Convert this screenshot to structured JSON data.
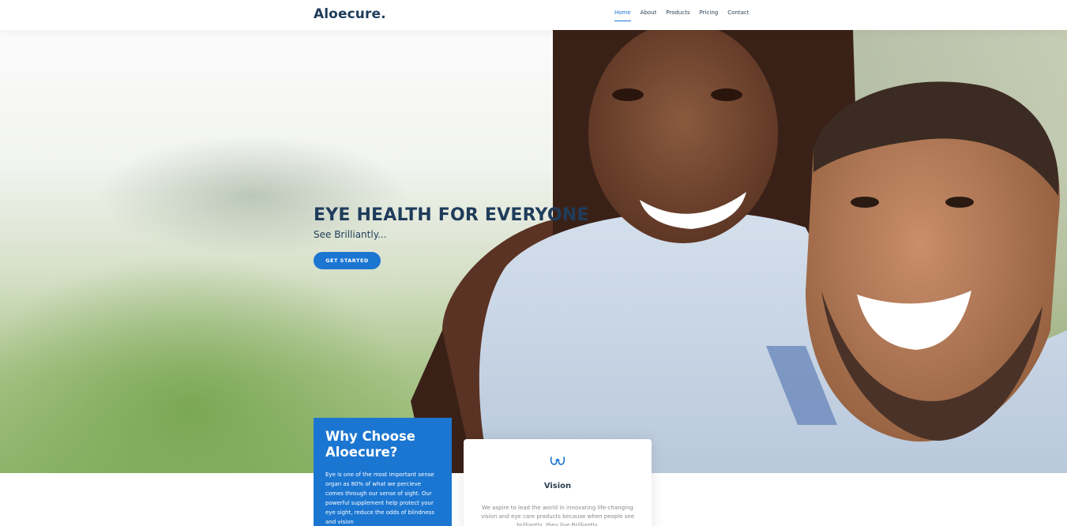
{
  "header": {
    "logo": "Aloecure.",
    "nav": [
      {
        "label": "Home",
        "active": true
      },
      {
        "label": "About",
        "active": false
      },
      {
        "label": "Products",
        "active": false
      },
      {
        "label": "Pricing",
        "active": false
      },
      {
        "label": "Contact",
        "active": false
      }
    ]
  },
  "hero": {
    "title": "EYE HEALTH FOR EVERYONE",
    "subtitle": "See Brilliantly...",
    "cta_label": "GET STARTED"
  },
  "why": {
    "title": "Why Choose Aloecure?",
    "text": "Eye is one of the most important sense organ as 80% of what we percieve comes through our sense of sight. Our powerful supplement help protect your eye sight, reduce the odds of blindness and vision"
  },
  "vision": {
    "icon": "glasses-icon",
    "title": "Vision",
    "text": "We aspire to lead the world in innovating life-changing vision and eye care products because when people see brilliantly, they live Brilliantly."
  },
  "colors": {
    "accent": "#1b76d1",
    "heading": "#1f3c5b"
  }
}
